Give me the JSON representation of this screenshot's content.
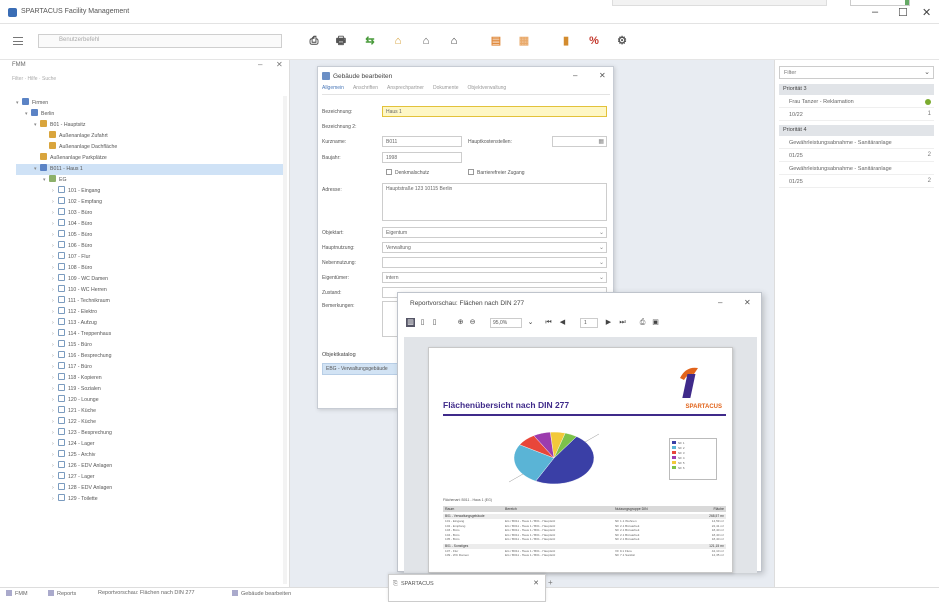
{
  "window": {
    "title": "SPARTACUS Facility Management",
    "minimize": "–",
    "maximize": "☐",
    "close": "✕"
  },
  "toolbar": {
    "search_placeholder": "Benutzerbefehl",
    "tools": [
      {
        "icon": "print-preview-icon",
        "glyph": "⎙",
        "color": "#444"
      },
      {
        "icon": "printer-icon",
        "glyph": "🖶",
        "color": "#555"
      },
      {
        "icon": "export-icon",
        "glyph": "⇆",
        "color": "#4a9b3c"
      },
      {
        "icon": "building-add-icon",
        "glyph": "⌂",
        "color": "#d39a2b"
      },
      {
        "icon": "building-icon",
        "glyph": "⌂",
        "color": "#555"
      },
      {
        "icon": "building-settings-icon",
        "glyph": "⌂",
        "color": "#333"
      },
      {
        "icon": "table-icon",
        "glyph": "▤",
        "color": "#e08a3c"
      },
      {
        "icon": "grid-icon",
        "glyph": "▦",
        "color": "#e9a96a"
      },
      {
        "icon": "chart-icon",
        "glyph": "▮",
        "color": "#d38b2e"
      },
      {
        "icon": "percent-icon",
        "glyph": "%",
        "color": "#c43a2f"
      },
      {
        "icon": "report-settings-icon",
        "glyph": "⚙",
        "color": "#555"
      }
    ]
  },
  "left_panel": {
    "title": "FMM",
    "tabs": "Filter · Hilfe · Suche",
    "tree": [
      {
        "indent": 0,
        "expander": "▾",
        "icon": "ic-blue",
        "label": "Firmen",
        "sel": false
      },
      {
        "indent": 1,
        "expander": "▾",
        "icon": "ic-blue",
        "label": "Berlin",
        "sel": false
      },
      {
        "indent": 2,
        "expander": "▾",
        "icon": "ic-gold",
        "label": "B01 - Hauptsitz",
        "sel": false
      },
      {
        "indent": 3,
        "expander": "",
        "icon": "ic-gold",
        "label": "Außenanlage Zufahrt",
        "sel": false
      },
      {
        "indent": 3,
        "expander": "",
        "icon": "ic-gold",
        "label": "Außenanlage Dachfläche",
        "sel": false
      },
      {
        "indent": 2,
        "expander": "",
        "icon": "ic-gold",
        "label": "Außenanlage Parkplätze",
        "sel": false
      },
      {
        "indent": 2,
        "expander": "▾",
        "icon": "ic-blue",
        "label": "B011 - Haus 1",
        "sel": true
      },
      {
        "indent": 3,
        "expander": "▾",
        "icon": "ic-green",
        "label": "EG",
        "sel": false
      },
      {
        "indent": 4,
        "expander": "›",
        "icon": "ic-room",
        "label": "101 - Eingang",
        "sel": false
      },
      {
        "indent": 4,
        "expander": "›",
        "icon": "ic-room",
        "label": "102 - Empfang",
        "sel": false
      },
      {
        "indent": 4,
        "expander": "›",
        "icon": "ic-room",
        "label": "103 - Büro",
        "sel": false
      },
      {
        "indent": 4,
        "expander": "›",
        "icon": "ic-room",
        "label": "104 - Büro",
        "sel": false
      },
      {
        "indent": 4,
        "expander": "›",
        "icon": "ic-room",
        "label": "105 - Büro",
        "sel": false
      },
      {
        "indent": 4,
        "expander": "›",
        "icon": "ic-room",
        "label": "106 - Büro",
        "sel": false
      },
      {
        "indent": 4,
        "expander": "›",
        "icon": "ic-room",
        "label": "107 - Flur",
        "sel": false
      },
      {
        "indent": 4,
        "expander": "›",
        "icon": "ic-room",
        "label": "108 - Büro",
        "sel": false
      },
      {
        "indent": 4,
        "expander": "›",
        "icon": "ic-room",
        "label": "109 - WC Damen",
        "sel": false
      },
      {
        "indent": 4,
        "expander": "›",
        "icon": "ic-room",
        "label": "110 - WC Herren",
        "sel": false
      },
      {
        "indent": 4,
        "expander": "›",
        "icon": "ic-room",
        "label": "111 - Technikraum",
        "sel": false
      },
      {
        "indent": 4,
        "expander": "›",
        "icon": "ic-room",
        "label": "112 - Elektro",
        "sel": false
      },
      {
        "indent": 4,
        "expander": "›",
        "icon": "ic-room",
        "label": "113 - Aufzug",
        "sel": false
      },
      {
        "indent": 4,
        "expander": "›",
        "icon": "ic-room",
        "label": "114 - Treppenhaus",
        "sel": false
      },
      {
        "indent": 4,
        "expander": "›",
        "icon": "ic-room",
        "label": "115 - Büro",
        "sel": false
      },
      {
        "indent": 4,
        "expander": "›",
        "icon": "ic-room",
        "label": "116 - Besprechung",
        "sel": false
      },
      {
        "indent": 4,
        "expander": "›",
        "icon": "ic-room",
        "label": "117 - Büro",
        "sel": false
      },
      {
        "indent": 4,
        "expander": "›",
        "icon": "ic-room",
        "label": "118 - Kopieren",
        "sel": false
      },
      {
        "indent": 4,
        "expander": "›",
        "icon": "ic-room",
        "label": "119 - Sozialen",
        "sel": false
      },
      {
        "indent": 4,
        "expander": "›",
        "icon": "ic-room",
        "label": "120 - Lounge",
        "sel": false
      },
      {
        "indent": 4,
        "expander": "›",
        "icon": "ic-room",
        "label": "121 - Küche",
        "sel": false
      },
      {
        "indent": 4,
        "expander": "›",
        "icon": "ic-room",
        "label": "122 - Küche",
        "sel": false
      },
      {
        "indent": 4,
        "expander": "›",
        "icon": "ic-room",
        "label": "123 - Besprechung",
        "sel": false
      },
      {
        "indent": 4,
        "expander": "›",
        "icon": "ic-room",
        "label": "124 - Lager",
        "sel": false
      },
      {
        "indent": 4,
        "expander": "›",
        "icon": "ic-room",
        "label": "125 - Archiv",
        "sel": false
      },
      {
        "indent": 4,
        "expander": "›",
        "icon": "ic-room",
        "label": "126 - EDV Anlagen",
        "sel": false
      },
      {
        "indent": 4,
        "expander": "›",
        "icon": "ic-room",
        "label": "127 - Lager",
        "sel": false
      },
      {
        "indent": 4,
        "expander": "›",
        "icon": "ic-room",
        "label": "128 - EDV Anlagen",
        "sel": false
      },
      {
        "indent": 4,
        "expander": "›",
        "icon": "ic-room",
        "label": "129 - Toilette",
        "sel": false
      }
    ]
  },
  "right_panel": {
    "selector": "Filter",
    "groups": [
      {
        "label": "Priorität 3",
        "items": [
          {
            "label": "Frau Tanzer - Reklamation",
            "tail": "",
            "dot": true
          },
          {
            "label": "10/22",
            "tail": "1",
            "dot": false
          }
        ]
      },
      {
        "label": "Priorität 4",
        "items": [
          {
            "label": "Gewährleistungsabnahme - Sanitäranlage",
            "tail": "",
            "dot": false
          },
          {
            "label": "01/25",
            "tail": "2",
            "dot": false
          },
          {
            "label": "Gewährleistungsabnahme - Sanitäranlage",
            "tail": "",
            "dot": false
          },
          {
            "label": "01/25",
            "tail": "2",
            "dot": false
          }
        ]
      }
    ]
  },
  "building_dialog": {
    "title": "Gebäude bearbeiten",
    "tabs": [
      "Allgemein",
      "Anschriften",
      "Ansprechpartner",
      "Dokumente",
      "Objektverwaltung"
    ],
    "labels": {
      "bezeichnung": "Bezeichnung:",
      "bezeichnung2": "Bezeichnung 2:",
      "kurzname": "Kurzname:",
      "baujahr": "Baujahr:",
      "adresse": "Adresse:",
      "objektart": "Objektart:",
      "hauptnutzung": "Hauptnutzung:",
      "nebennutzung": "Nebennutzung:",
      "eigentuemer": "Eigentümer:",
      "zustand": "Zustand:",
      "bemerkungen": "Bemerkungen:",
      "kostenstelle": "Hauptkostenstellen:"
    },
    "values": {
      "bezeichnung": "Haus 1",
      "bezeichnung2": "",
      "kurzname": "B011",
      "baujahr": "1998",
      "adresse": "Hauptstraße 123 10115 Berlin",
      "objektart": "Eigentum",
      "hauptnutzung": "Verwaltung",
      "nebennutzung": "",
      "eigentuemer": "intern",
      "zustand": "",
      "bemerkungen": "",
      "kostenstelle": ""
    },
    "checks": {
      "denkmal": "Denkmalschutz",
      "barrierefrei": "Barrierefreier Zugang"
    },
    "section_label": "Objektkatalog",
    "section_row": "EBG - Verwaltungsgebäude"
  },
  "report_window": {
    "title": "Reportvorschau: Flächen nach DIN 277",
    "zoom": "95,0%",
    "page": "1",
    "paper": {
      "title": "Flächenübersicht nach DIN 277",
      "brand": "SPARTACUS",
      "meta": "Flächenart:        B011 - Haus 1 (EG)",
      "headers": [
        "Raum",
        "Bereich",
        "Nutzungsgruppe DIN",
        "Fläche"
      ],
      "band1": [
        "B01 - Verwaltungsgebäude",
        "",
        "",
        "268,57 m²"
      ],
      "rows1": [
        [
          "101 - Eingang",
          "EG / B011 - Haus 1 / B01 - Hauptsitz",
          "NF 1.1 Wohnen",
          "14,59 m²"
        ],
        [
          "102 - Empfang",
          "EG / B011 - Haus 1 / B01 - Hauptsitz",
          "NF 2.1 Büroarbeit",
          "22,41 m²"
        ],
        [
          "103 - Büro",
          "EG / B011 - Haus 1 / B01 - Hauptsitz",
          "NF 2.1 Büroarbeit",
          "18,40 m²"
        ],
        [
          "104 - Büro",
          "EG / B011 - Haus 1 / B01 - Hauptsitz",
          "NF 2.1 Büroarbeit",
          "18,40 m²"
        ],
        [
          "105 - Büro",
          "EG / B011 - Haus 1 / B01 - Hauptsitz",
          "NF 2.1 Büroarbeit",
          "18,40 m²"
        ]
      ],
      "band2": [
        "B01 - Sonstiges",
        "",
        "",
        "121,15 m²"
      ],
      "rows2": [
        [
          "107 - Flur",
          "EG / B011 - Haus 1 / B01 - Hauptsitz",
          "VF 9.1 Flure",
          "42,10 m²"
        ],
        [
          "109 - WC Damen",
          "EG / B011 - Haus 1 / B01 - Hauptsitz",
          "NF 7.1 Sanitär",
          "12,35 m²"
        ]
      ]
    }
  },
  "bottom": {
    "tabs": [
      "FMM",
      "Reports",
      "Reportvorschau: Flächen nach DIN 277",
      "Gebäude bearbeiten"
    ],
    "small_window_title": "SPARTACUS",
    "add_tab": "+"
  },
  "chart_data": {
    "type": "pie",
    "title": "",
    "slices": [
      {
        "label": "NF 1",
        "value": 48,
        "color": "#3a3fa6"
      },
      {
        "label": "NF 2",
        "value": 26,
        "color": "#5ab4d6"
      },
      {
        "label": "NF 3",
        "value": 8,
        "color": "#e8463a"
      },
      {
        "label": "NF 4",
        "value": 7,
        "color": "#9c3cae"
      },
      {
        "label": "NF 5",
        "value": 6,
        "color": "#f2c93a"
      },
      {
        "label": "NF 6",
        "value": 5,
        "color": "#7cc24a"
      }
    ]
  }
}
